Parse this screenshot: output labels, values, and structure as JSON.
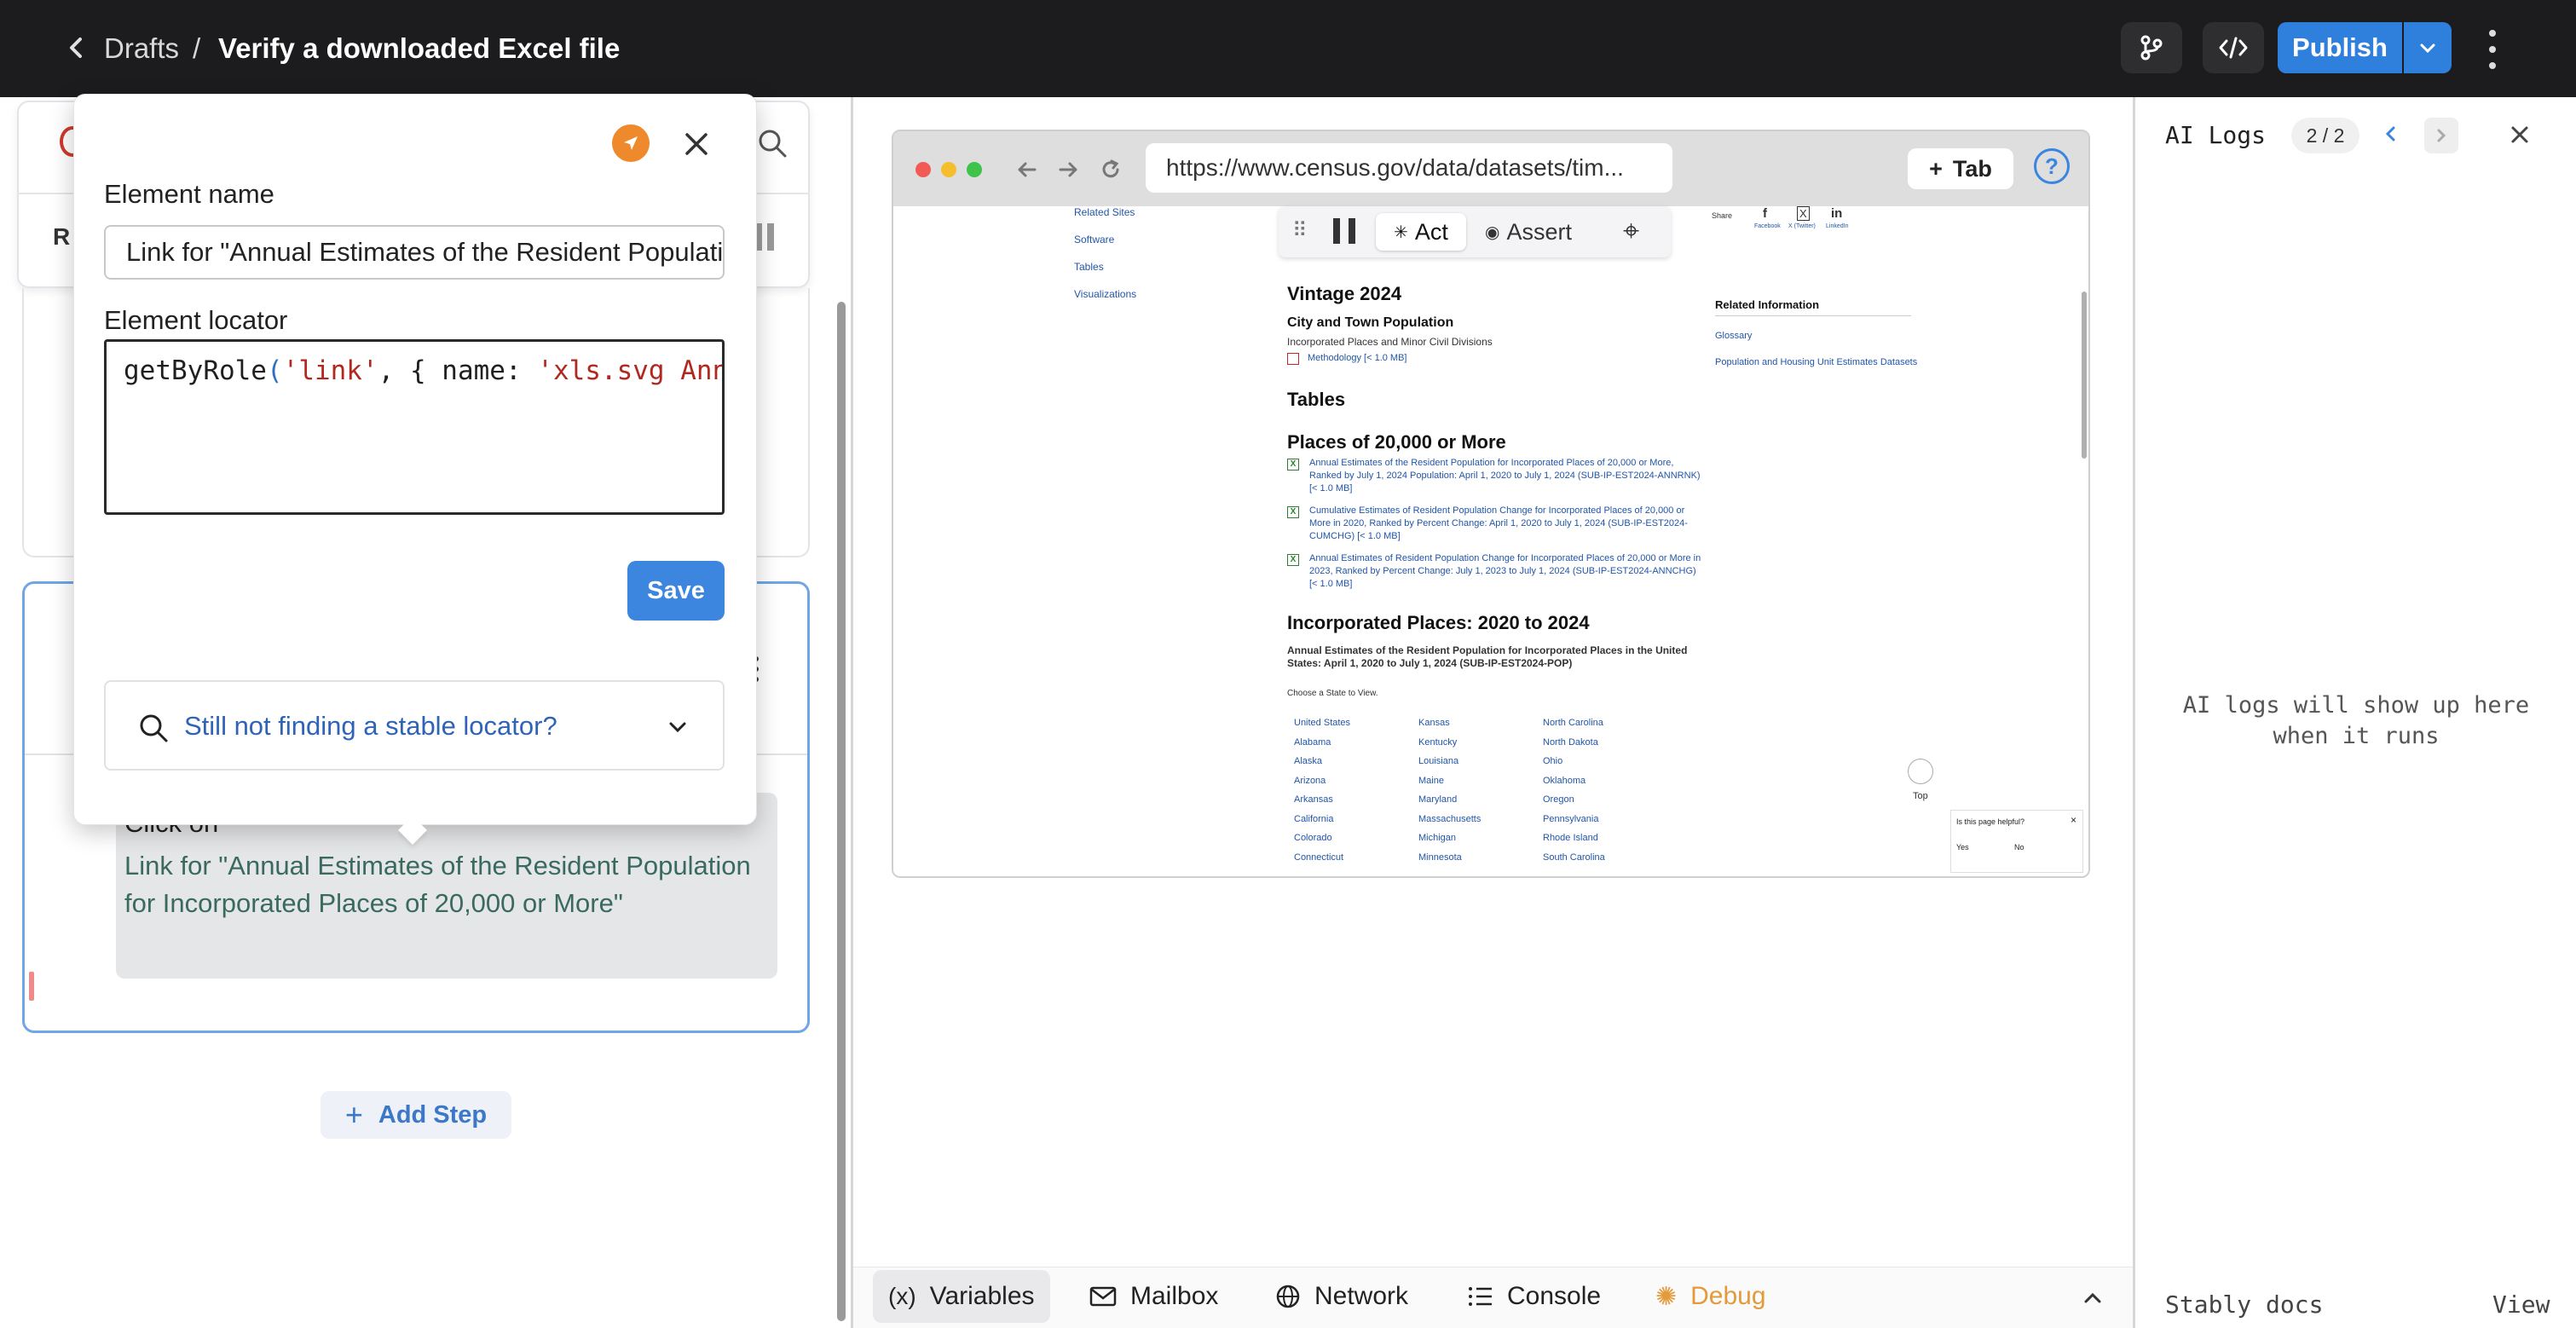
{
  "header": {
    "back_icon": "chevron-left-icon",
    "breadcrumb_parent": "Drafts",
    "breadcrumb_separator": "/",
    "title": "Verify a downloaded Excel file",
    "branch_icon": "git-branch-icon",
    "code_icon": "code-icon",
    "publish_label": "Publish"
  },
  "left": {
    "partial_label": "R",
    "step": {
      "action": "Click on",
      "target": "Link for \"Annual Estimates of the Resident Population for Incorporated Places of 20,000 or More\""
    },
    "add_step_label": "Add Step"
  },
  "popover": {
    "name_label": "Element name",
    "name_value": "Link for \"Annual Estimates of the Resident Population for Incorporated Places of 20,000 or More\"",
    "locator_label": "Element locator",
    "locator": {
      "fn": "getByRole",
      "p1": "(",
      "s1": "'link'",
      "p2": ", { ",
      "k1": "name: ",
      "s2": "'xls.svg Annual Estimates"
    },
    "save_label": "Save",
    "stable_hint": "Still not finding a stable locator?"
  },
  "browser": {
    "url": "https://www.census.gov/data/datasets/tim...",
    "tab_label": "Tab",
    "help_label": "?",
    "toolbar": {
      "act_label": "Act",
      "assert_label": "Assert"
    },
    "page": {
      "side_links": [
        "Related Sites",
        "Software",
        "Tables",
        "Visualizations"
      ],
      "share_label": "Share",
      "share_items": [
        "Facebook",
        "X (Twitter)",
        "LinkedIn"
      ],
      "vintage_heading": "Vintage 2024",
      "city_town_heading": "City and Town Population",
      "city_town_sub": "Incorporated Places and Minor Civil Divisions",
      "methodology_link": "Methodology [< 1.0 MB]",
      "tables_heading": "Tables",
      "places_heading": "Places of 20,000 or More",
      "entries": [
        "Annual Estimates of the Resident Population for Incorporated Places of 20,000 or More, Ranked by July 1, 2024 Population: April 1, 2020 to July 1, 2024 (SUB-IP-EST2024-ANNRNK) [< 1.0 MB]",
        "Cumulative Estimates of Resident Population Change for Incorporated Places of 20,000 or More in 2020, Ranked by Percent Change: April 1, 2020 to July 1, 2024 (SUB-IP-EST2024-CUMCHG) [< 1.0 MB]",
        "Annual Estimates of Resident Population Change for Incorporated Places of 20,000 or More in 2023, Ranked by Percent Change: July 1, 2023 to July 1, 2024 (SUB-IP-EST2024-ANNCHG) [< 1.0 MB]"
      ],
      "incorporated_heading": "Incorporated Places: 2020 to 2024",
      "incorporated_desc": "Annual Estimates of the Resident Population for Incorporated Places in the United States: April 1, 2020 to July 1, 2024 (SUB-IP-EST2024-POP)",
      "choose_state": "Choose a State to View.",
      "states_col1": [
        "United States",
        "Alabama",
        "Alaska",
        "Arizona",
        "Arkansas",
        "California",
        "Colorado",
        "Connecticut"
      ],
      "states_col2": [
        "Kansas",
        "Kentucky",
        "Louisiana",
        "Maine",
        "Maryland",
        "Massachusetts",
        "Michigan",
        "Minnesota"
      ],
      "states_col3": [
        "North Carolina",
        "North Dakota",
        "Ohio",
        "Oklahoma",
        "Oregon",
        "Pennsylvania",
        "Rhode Island",
        "South Carolina"
      ],
      "related_heading": "Related Information",
      "related_links": [
        "Glossary",
        "Population and Housing Unit Estimates Datasets"
      ],
      "helpful_question": "Is this page helpful?",
      "helpful_yes": "Yes",
      "helpful_no": "No",
      "top_label": "Top"
    }
  },
  "bottom_tabs": [
    {
      "label": "Variables",
      "icon": "variable-icon"
    },
    {
      "label": "Mailbox",
      "icon": "mail-icon"
    },
    {
      "label": "Network",
      "icon": "globe-icon"
    },
    {
      "label": "Console",
      "icon": "list-icon"
    },
    {
      "label": "Debug",
      "icon": "bug-icon"
    }
  ],
  "right": {
    "title": "AI Logs",
    "count": "2 / 2",
    "empty_message": "AI logs will show up here when it runs",
    "docs_label": "Stably docs",
    "view_label": "View"
  },
  "colors": {
    "accent": "#2f7fdc",
    "topbar": "#1c1c1e",
    "debug": "#e39a3a",
    "locator_string": "#b0281f"
  }
}
